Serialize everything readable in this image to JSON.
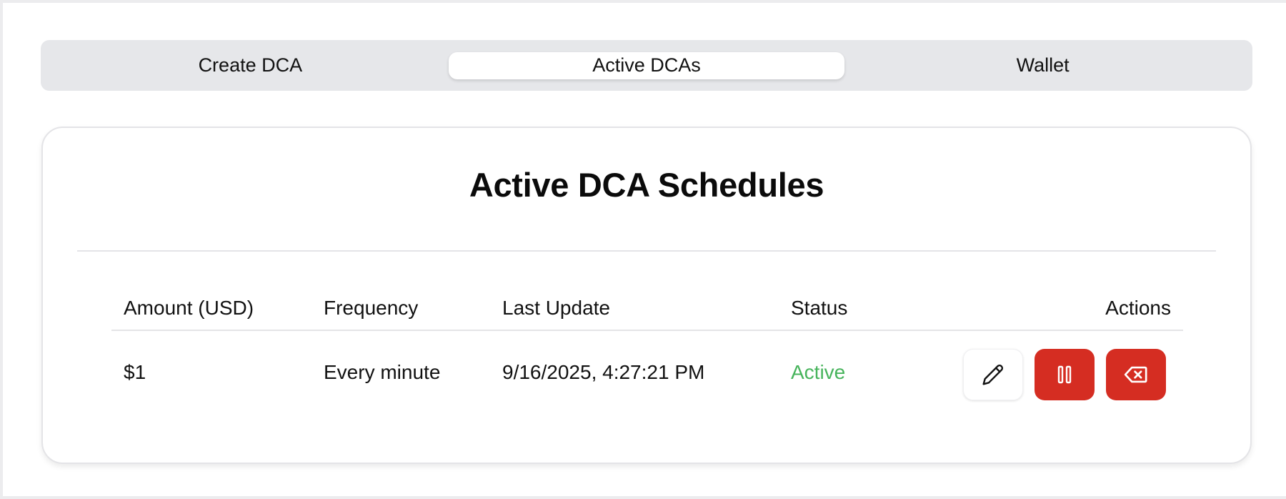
{
  "tabs": [
    {
      "label": "Create DCA",
      "active": false
    },
    {
      "label": "Active DCAs",
      "active": true
    },
    {
      "label": "Wallet",
      "active": false
    }
  ],
  "card": {
    "title": "Active DCA Schedules"
  },
  "table": {
    "headers": {
      "amount": "Amount (USD)",
      "frequency": "Frequency",
      "last_update": "Last Update",
      "status": "Status",
      "actions": "Actions"
    },
    "rows": [
      {
        "amount": "$1",
        "frequency": "Every minute",
        "last_update": "9/16/2025, 4:27:21 PM",
        "status": "Active",
        "actions": [
          "pencil-icon",
          "pause-icon",
          "backspace-delete-icon"
        ]
      }
    ]
  },
  "colors": {
    "accent_danger": "#d52d22",
    "status_active": "#47b45c",
    "tab_bar": "#e6e7ea"
  }
}
